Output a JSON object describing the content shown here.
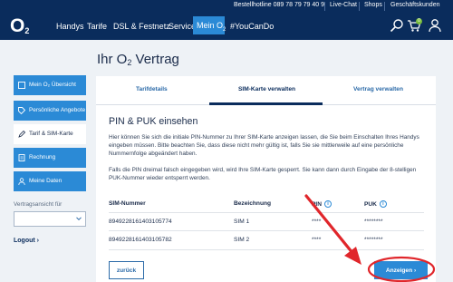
{
  "topbar": {
    "hotline": "Bestellhotline 089 78 79 79 40 9",
    "live_chat": "Live-Chat",
    "shops": "Shops",
    "business": "Geschäftskunden"
  },
  "nav": {
    "logo_main": "O",
    "logo_sub": "2",
    "items": [
      "Handys",
      "Tarife",
      "DSL & Festnetz",
      "Service"
    ],
    "active_main": "Mein O",
    "active_sub": "2",
    "youcando": "#YouCanDo",
    "cart_count": "0",
    "icons": [
      "search-icon",
      "cart-icon",
      "user-icon"
    ]
  },
  "page": {
    "title_main": "Ihr O",
    "title_sub": "2",
    "title_rest": " Vertrag"
  },
  "sidebar": {
    "items": [
      {
        "label": "Mein O₂ Übersicht",
        "icon": "home-icon"
      },
      {
        "label": "Persönliche Angebote",
        "icon": "tag-icon"
      },
      {
        "label": "Tarif & SIM-Karte",
        "icon": "pencil-icon"
      },
      {
        "label": "Rechnung",
        "icon": "invoice-icon"
      },
      {
        "label": "Meine Daten",
        "icon": "person-icon"
      }
    ],
    "contract_view_label": "Vertragsansicht für",
    "contract_view_value": "",
    "logout": "Logout",
    "logout_chevron": "›"
  },
  "tabs": [
    {
      "label": "Tarifdetails",
      "active": false
    },
    {
      "label": "SIM-Karte verwalten",
      "active": true
    },
    {
      "label": "Vertrag verwalten",
      "active": false
    }
  ],
  "content": {
    "heading": "PIN & PUK einsehen",
    "para1": "Hier können Sie sich die initiale PIN-Nummer zu Ihrer SIM-Karte anzeigen lassen, die Sie beim Einschalten Ihres Handys eingeben müssen. Bitte beachten Sie, dass diese nicht mehr gültig ist, falls Sie sie mittlerweile auf eine persönliche Nummernfolge abgeändert haben.",
    "para2": "Falls die PIN dreimal falsch eingegeben wird, wird Ihre SIM-Karte gesperrt. Sie kann dann durch Eingabe der 8-stelligen PUK-Nummer wieder entsperrt werden."
  },
  "table": {
    "headers": [
      "SIM-Nummer",
      "Bezeichnung",
      "PIN",
      "PUK"
    ],
    "info_glyph": "i",
    "rows": [
      {
        "sim": "8949228161403105774",
        "name": "SIM 1",
        "pin": "****",
        "puk": "********"
      },
      {
        "sim": "8949228161403105782",
        "name": "SIM 2",
        "pin": "****",
        "puk": "********"
      }
    ]
  },
  "buttons": {
    "back": "zurück",
    "show": "Anzeigen",
    "show_chevron": "›"
  },
  "colors": {
    "navy": "#0a2c5c",
    "accent_blue": "#2b8ad6",
    "annotation_red": "#e0262b",
    "badge_green": "#79bd3d"
  }
}
